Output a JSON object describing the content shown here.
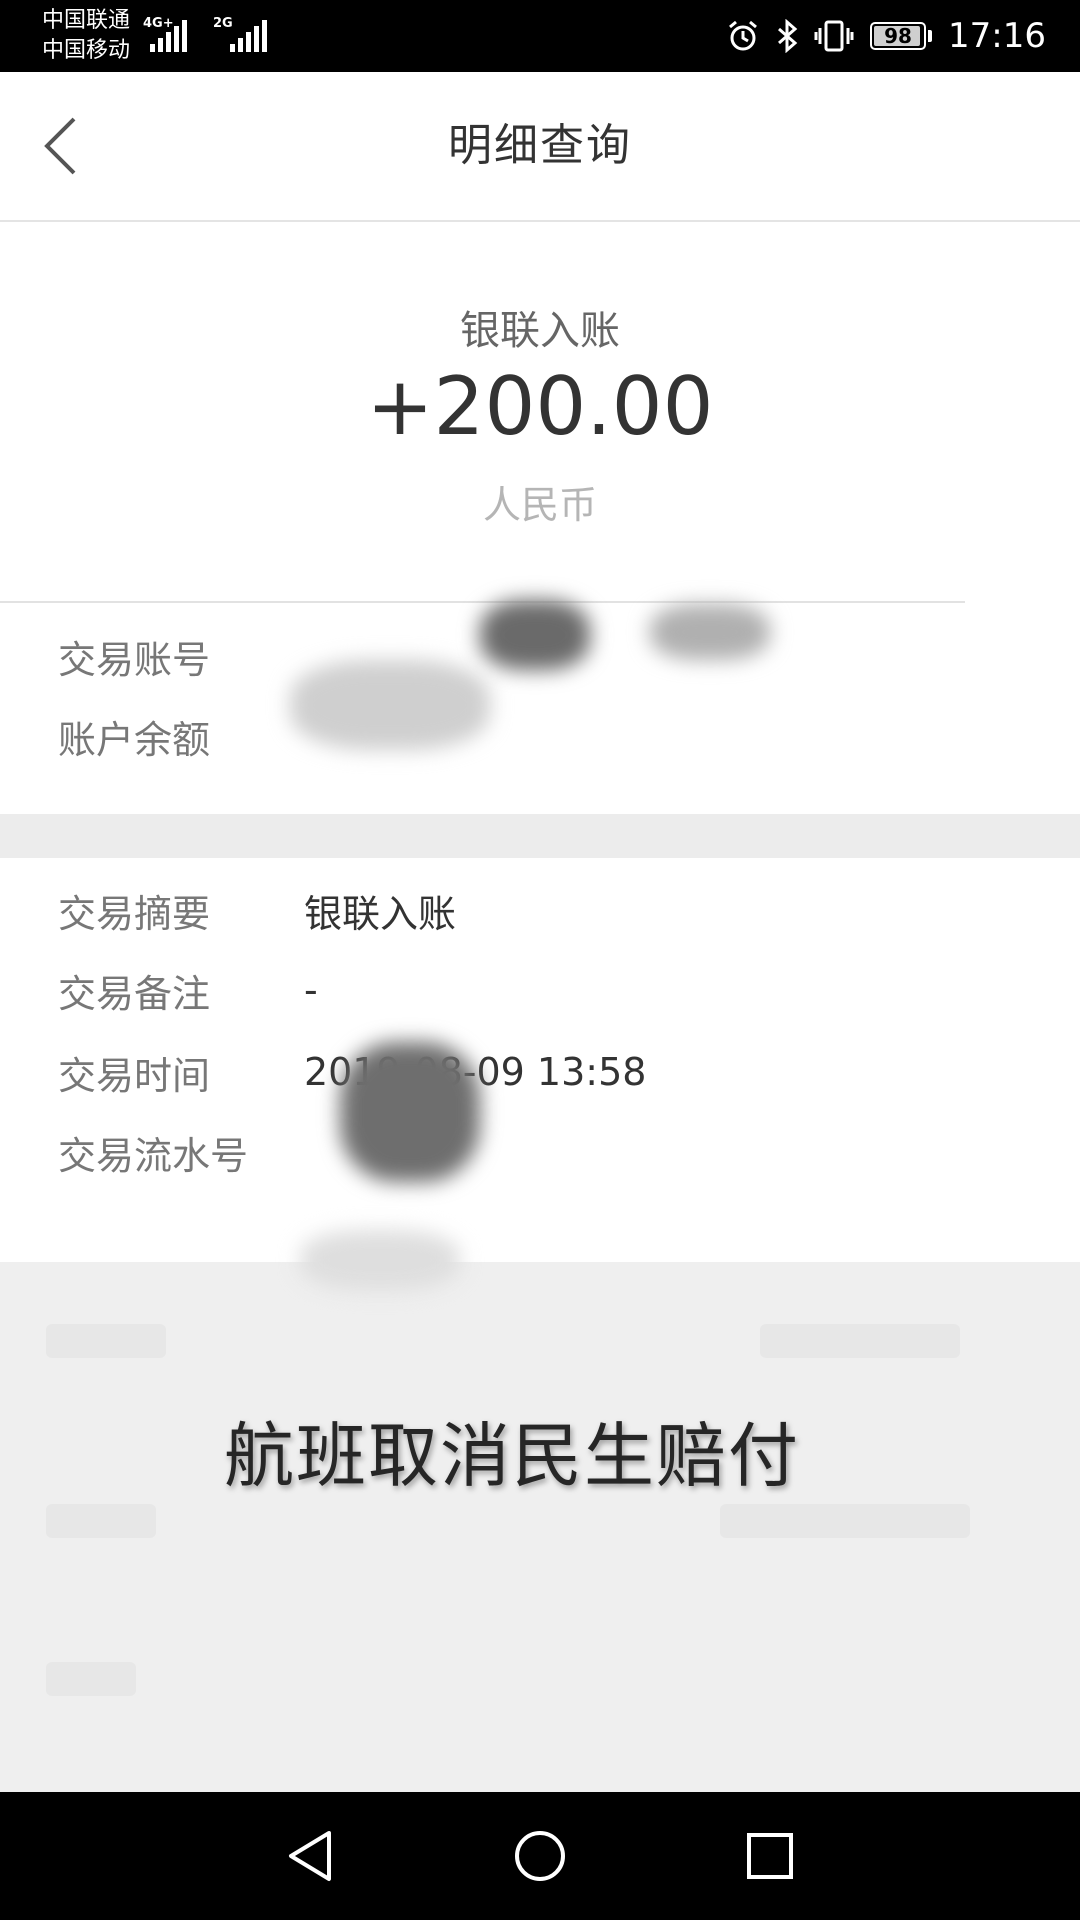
{
  "status_bar": {
    "carrier_1": "中国联通",
    "carrier_2": "中国移动",
    "net_1": "4G+",
    "net_2": "2G",
    "battery": "98",
    "time": "17:16"
  },
  "header": {
    "title": "明细查询",
    "back_icon": "chevron-left-icon"
  },
  "summary": {
    "transaction_type": "银联入账",
    "amount": "+200.00",
    "currency": "人民币"
  },
  "account": {
    "account_label": "交易账号",
    "balance_label": "账户余额"
  },
  "details": {
    "summary_label": "交易摘要",
    "summary_value": "银联入账",
    "remark_label": "交易备注",
    "remark_value": "-",
    "time_label": "交易时间",
    "time_value": "2019-08-09 13:58",
    "serial_label": "交易流水号"
  },
  "overlay_caption": "航班取消民生赔付",
  "colors": {
    "status_bar": "#000000",
    "background": "#ffffff",
    "bottom_area": "#efefef",
    "text_primary": "#333333",
    "text_label": "#777777",
    "text_muted": "#b5b5b5"
  }
}
